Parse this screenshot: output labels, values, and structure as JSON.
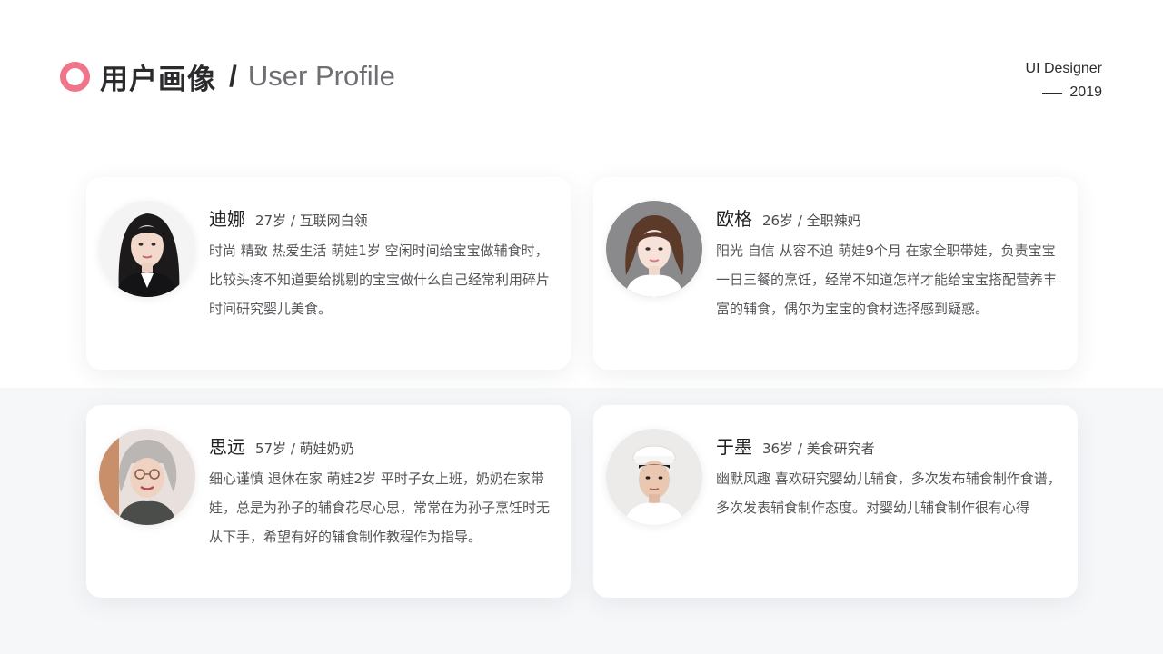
{
  "header": {
    "title_cn": "用户画像",
    "separator": "/",
    "title_en": "User Profile",
    "accent_color": "#f0748a"
  },
  "signature": {
    "role": "UI Designer",
    "year": "2019"
  },
  "personas": [
    {
      "name": "迪娜",
      "meta": "27岁 / 互联网白领",
      "description": "时尚 精致 热爱生活 萌娃1岁 空闲时间给宝宝做辅食时，比较头疼不知道要给挑剔的宝宝做什么自己经常利用碎片时间研究婴儿美食。",
      "avatar_icon": "woman-avatar-icon"
    },
    {
      "name": "欧格",
      "meta": "26岁 / 全职辣妈",
      "description": "阳光 自信 从容不迫 萌娃9个月 在家全职带娃，负责宝宝一日三餐的烹饪，经常不知道怎样才能给宝宝搭配营养丰富的辅食，偶尔为宝宝的食材选择感到疑惑。",
      "avatar_icon": "young-woman-avatar-icon"
    },
    {
      "name": "思远",
      "meta": "57岁 / 萌娃奶奶",
      "description": "细心谨慎 退休在家 萌娃2岁 平时子女上班，奶奶在家带娃，总是为孙子的辅食花尽心思，常常在为孙子烹饪时无从下手，希望有好的辅食制作教程作为指导。",
      "avatar_icon": "grandmother-avatar-icon"
    },
    {
      "name": "于墨",
      "meta": "36岁 / 美食研究者",
      "description": "幽默风趣 喜欢研究婴幼儿辅食，多次发布辅食制作食谱，多次发表辅食制作态度。对婴幼儿辅食制作很有心得",
      "avatar_icon": "chef-avatar-icon"
    }
  ]
}
